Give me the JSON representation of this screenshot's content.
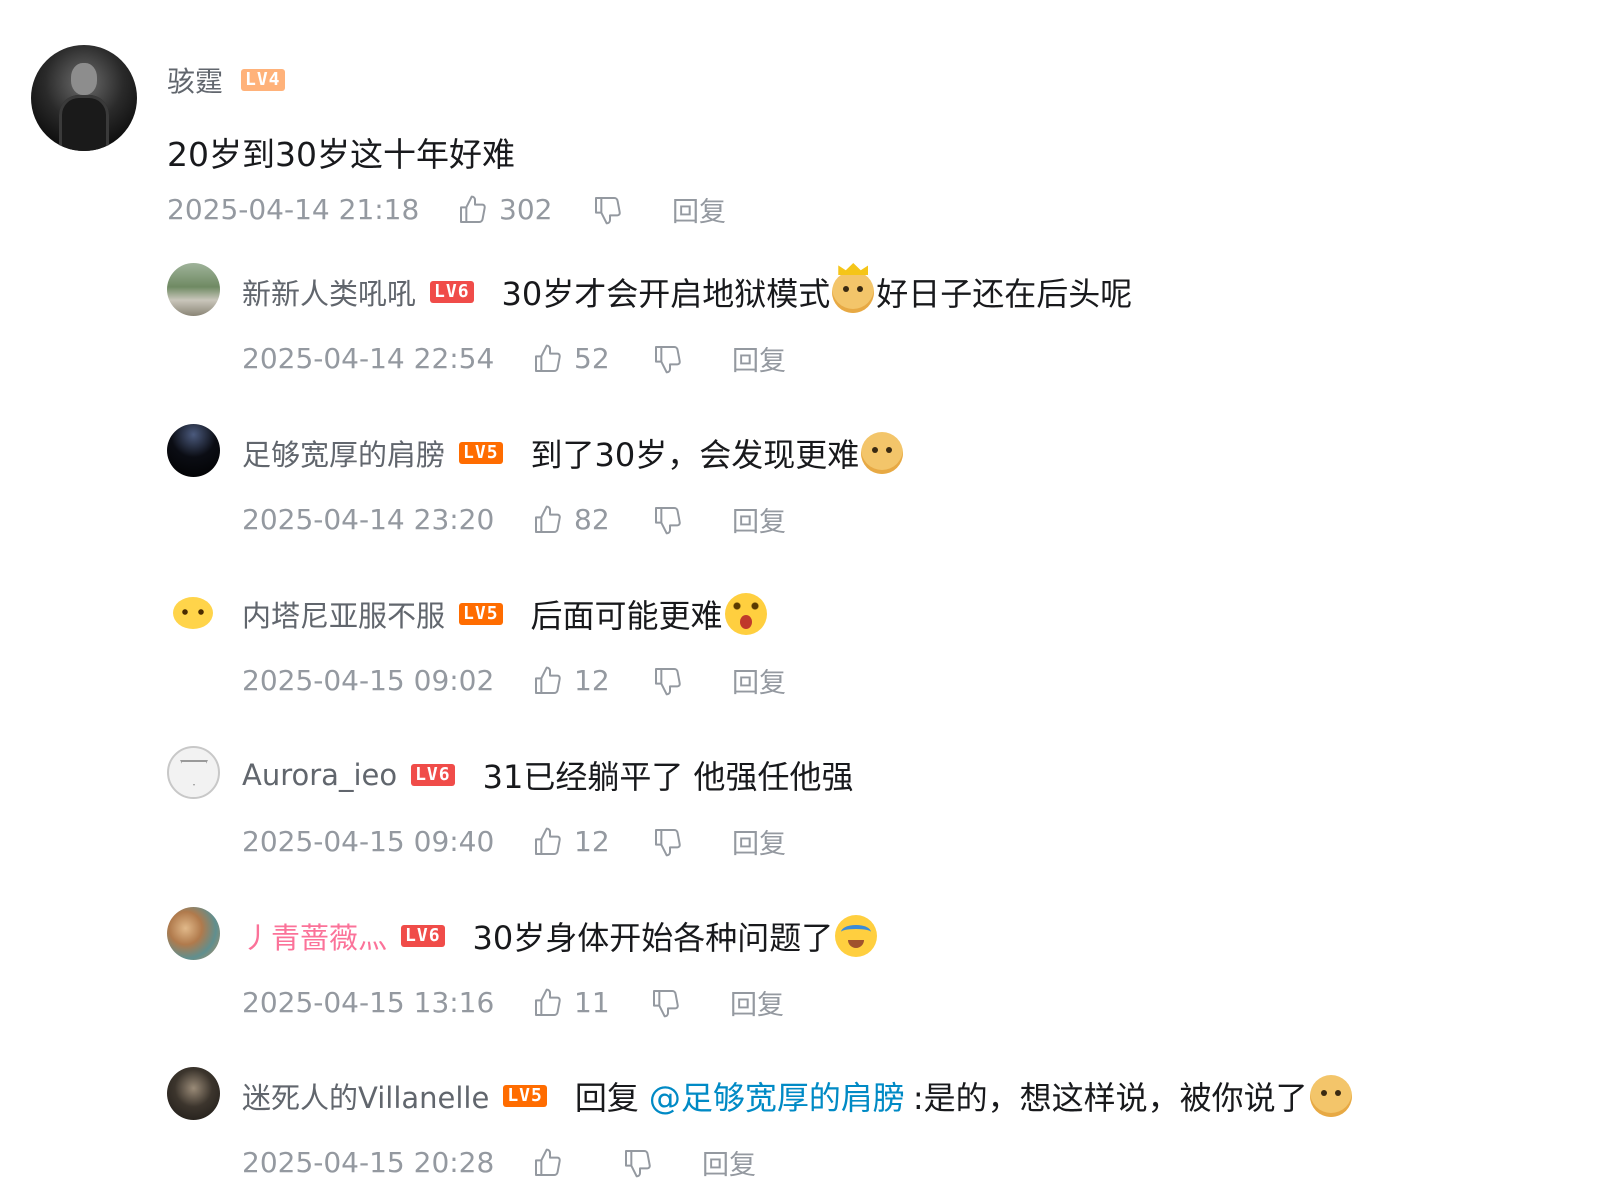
{
  "colors": {
    "level_badge_lv4": "#ffb27a",
    "level_badge_lv5": "#ff6c00",
    "level_badge_lv6": "#f04c49",
    "meta_gray": "#9499a0",
    "name_gray": "#61666d",
    "mention_blue": "#008ac5",
    "pink_name": "#fb7299"
  },
  "root": {
    "username": "骇霆",
    "level": "LV4",
    "content": "20岁到30岁这十年好难",
    "time": "2025-04-14 21:18",
    "likes": "302",
    "reply_label": "回复"
  },
  "replies": [
    {
      "username": "新新人类吼吼",
      "level": "LV6",
      "content_before": "30岁才会开启地狱模式",
      "emote": "doge-crown-emote",
      "content_after": "好日子还在后头呢",
      "time": "2025-04-14 22:54",
      "likes": "52",
      "reply_label": "回复"
    },
    {
      "username": "足够宽厚的肩膀",
      "level": "LV5",
      "content_before": "到了30岁，会发现更难",
      "emote": "doge-emote",
      "content_after": "",
      "time": "2025-04-14 23:20",
      "likes": "82",
      "reply_label": "回复"
    },
    {
      "username": "内塔尼亚服不服",
      "level": "LV5",
      "content_before": "后面可能更难",
      "emote": "shock-emote",
      "content_after": "",
      "time": "2025-04-15 09:02",
      "likes": "12",
      "reply_label": "回复"
    },
    {
      "username": "Aurora_ieo",
      "level": "LV6",
      "content_before": "31已经躺平了 他强任他强",
      "emote": "",
      "content_after": "",
      "time": "2025-04-15 09:40",
      "likes": "12",
      "reply_label": "回复"
    },
    {
      "username": "丿青蔷薇灬",
      "level": "LV6",
      "content_before": "30岁身体开始各种问题了",
      "emote": "cry-laugh-emote",
      "content_after": "",
      "time": "2025-04-15 13:16",
      "likes": "11",
      "reply_label": "回复"
    },
    {
      "username": "迷死人的Villanelle",
      "level": "LV5",
      "reply_prefix": "回复",
      "mention": "@足够宽厚的肩膀",
      "content_before": ":是的，想这样说，被你说了",
      "emote": "doge-emote",
      "content_after": "",
      "time": "2025-04-15 20:28",
      "likes": "",
      "reply_label": "回复"
    }
  ]
}
